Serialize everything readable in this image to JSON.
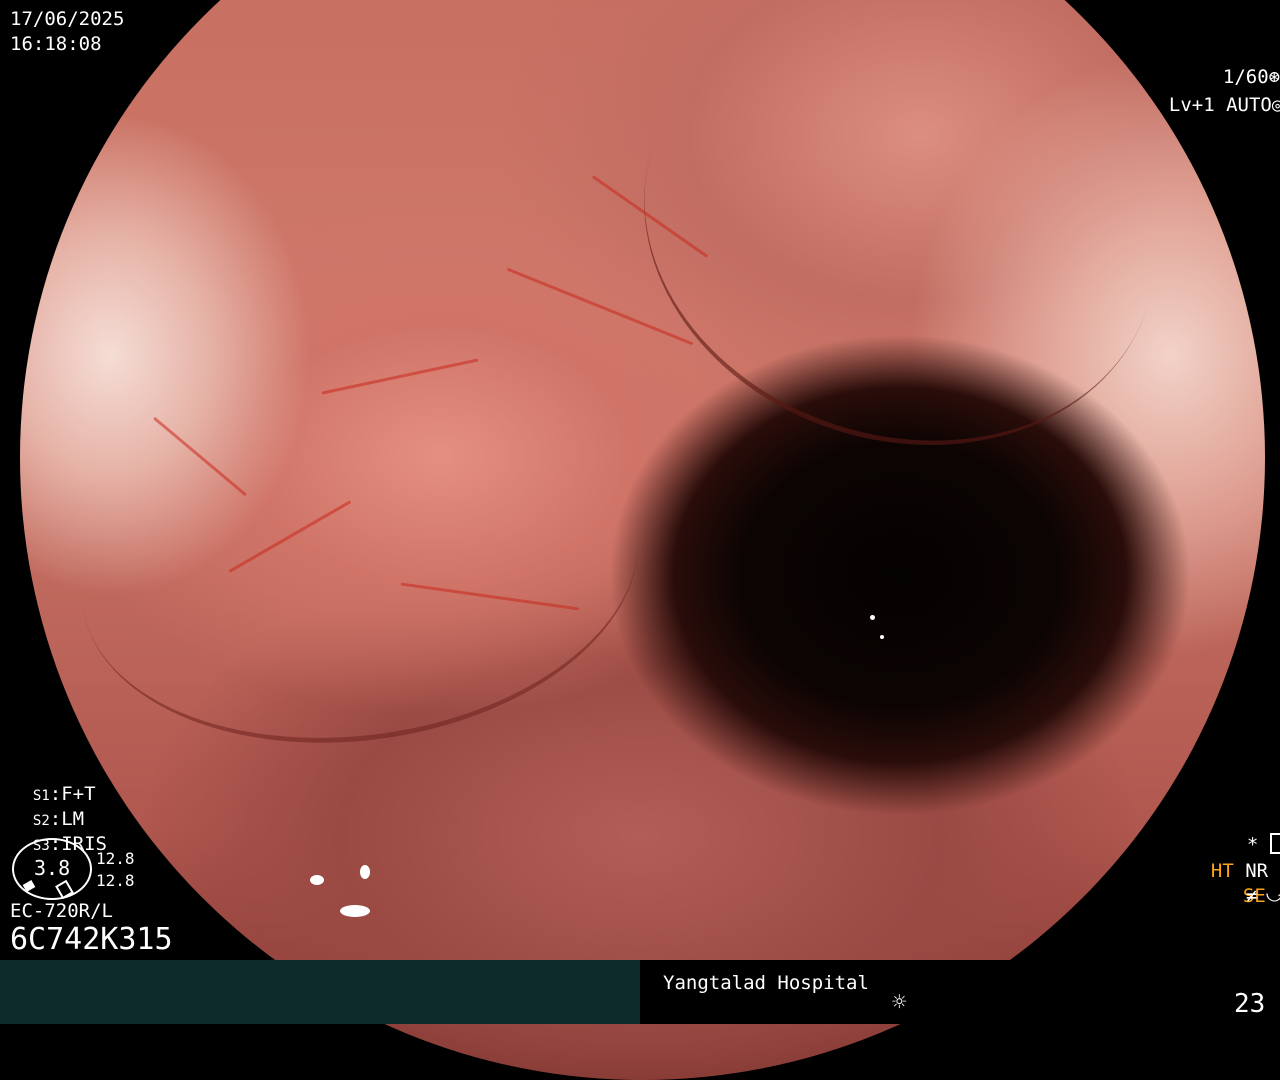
{
  "datetime": {
    "date": "17/06/2025",
    "time": "16:18:08"
  },
  "exposure": {
    "shutter": "1/60",
    "level": "Lv+1",
    "iris_mode": "AUTO"
  },
  "settings": {
    "s1": {
      "label": "S1",
      "value": "F+T"
    },
    "s2": {
      "label": "S2",
      "value": "LM"
    },
    "s3": {
      "label": "S3",
      "value": "IRIS"
    }
  },
  "gauge": {
    "value": "3.8",
    "upper": "12.8",
    "lower": "12.8"
  },
  "scope": {
    "model": "EC-720R/L",
    "serial": "6C742K315"
  },
  "modes": {
    "star": "*",
    "ht": "HT",
    "nr": "NR",
    "se": "SE",
    "not_equal": "≠"
  },
  "footer": {
    "hospital": "Yangtalad Hospital",
    "frame": "23"
  },
  "colors": {
    "indicator_orange": "#ffa31a",
    "footer_bar": "#0d2a2a"
  }
}
